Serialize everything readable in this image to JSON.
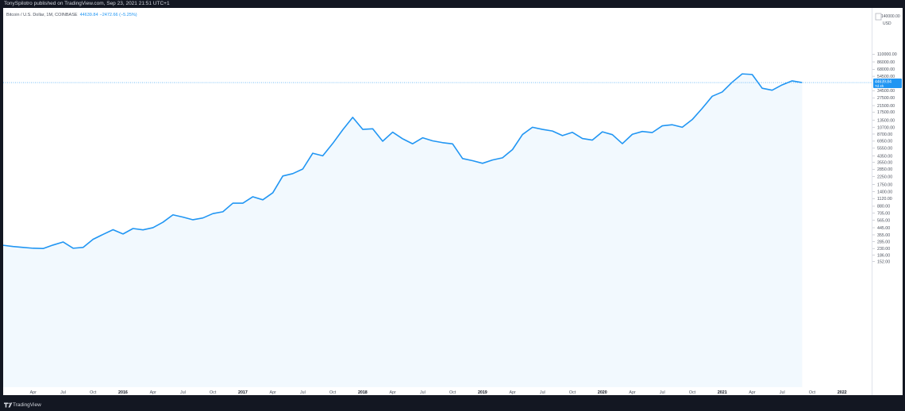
{
  "header": {
    "publisher_line": "TonySpilotro published on TradingView.com, Sep 23, 2021 21:51 UTC+1"
  },
  "legend": {
    "symbol": "Bitcoin / U.S. Dollar, 1M, COINBASE",
    "last_price": "44639.84",
    "change": "−2472.66 (−5.25%)"
  },
  "price_axis": {
    "top_label": "140000.00",
    "currency": "USD"
  },
  "price_tag": {
    "value": "44639.84",
    "countdown": "7d 4h"
  },
  "footer": {
    "brand": "TradingView",
    "brand_icon": "tradingview-logo-icon"
  },
  "colors": {
    "line": "#2196f3",
    "area_fill": "#2196f3",
    "background": "#ffffff",
    "frame": "#131722",
    "axis_text": "#4c525e"
  },
  "chart_data": {
    "type": "area",
    "title": "",
    "xlabel": "",
    "ylabel": "",
    "y_scale": "log",
    "grid": false,
    "x_ticks": [
      "Apr",
      "Jul",
      "Oct",
      "2016",
      "Apr",
      "Jul",
      "Oct",
      "2017",
      "Apr",
      "Jul",
      "Oct",
      "2018",
      "Apr",
      "Jul",
      "Oct",
      "2019",
      "Apr",
      "Jul",
      "Oct",
      "2020",
      "Apr",
      "Jul",
      "Oct",
      "2021",
      "Apr",
      "Jul",
      "Oct",
      "2022",
      "A"
    ],
    "y_ticks": [
      "110000.00",
      "86000.00",
      "68000.00",
      "54500.00",
      "34500.00",
      "27500.00",
      "21500.00",
      "17500.00",
      "13500.00",
      "10700.00",
      "8700.00",
      "6950.00",
      "5550.00",
      "4350.00",
      "3550.00",
      "2850.00",
      "2250.00",
      "1750.00",
      "1400.00",
      "1120.00",
      "880.00",
      "705.00",
      "565.00",
      "445.00",
      "355.00",
      "285.00",
      "230.00",
      "186.00",
      "152.00"
    ],
    "series": [
      {
        "x": [
          "2015-01",
          "2015-02",
          "2015-03",
          "2015-04",
          "2015-05",
          "2015-06",
          "2015-07",
          "2015-08",
          "2015-09",
          "2015-10",
          "2015-11",
          "2015-12",
          "2016-01",
          "2016-02",
          "2016-03",
          "2016-04",
          "2016-05",
          "2016-06",
          "2016-07",
          "2016-08",
          "2016-09",
          "2016-10",
          "2016-11",
          "2016-12",
          "2017-01",
          "2017-02",
          "2017-03",
          "2017-04",
          "2017-05",
          "2017-06",
          "2017-07",
          "2017-08",
          "2017-09",
          "2017-10",
          "2017-11",
          "2017-12",
          "2018-01",
          "2018-02",
          "2018-03",
          "2018-04",
          "2018-05",
          "2018-06",
          "2018-07",
          "2018-08",
          "2018-09",
          "2018-10",
          "2018-11",
          "2018-12",
          "2019-01",
          "2019-02",
          "2019-03",
          "2019-04",
          "2019-05",
          "2019-06",
          "2019-07",
          "2019-08",
          "2019-09",
          "2019-10",
          "2019-11",
          "2019-12",
          "2020-01",
          "2020-02",
          "2020-03",
          "2020-04",
          "2020-05",
          "2020-06",
          "2020-07",
          "2020-08",
          "2020-09",
          "2020-10",
          "2020-11",
          "2020-12",
          "2021-01",
          "2021-02",
          "2021-03",
          "2021-04",
          "2021-05",
          "2021-06",
          "2021-07",
          "2021-08",
          "2021-09"
        ],
        "values": [
          255,
          245,
          238,
          232,
          230,
          257,
          283,
          232,
          238,
          308,
          360,
          418,
          365,
          434,
          416,
          446,
          530,
          670,
          623,
          573,
          607,
          697,
          739,
          970,
          970,
          1190,
          1080,
          1350,
          2300,
          2480,
          2870,
          4740,
          4360,
          6460,
          9950,
          14800,
          10100,
          10300,
          6930,
          9240,
          7490,
          6390,
          7730,
          7020,
          6630,
          6370,
          4000,
          3740,
          3440,
          3820,
          4100,
          5320,
          8570,
          10800,
          10100,
          9590,
          8290,
          9200,
          7560,
          7190,
          9350,
          8550,
          6420,
          8640,
          9450,
          9140,
          11300,
          11700,
          10800,
          13800,
          19700,
          28900,
          33100,
          45200,
          58800,
          57700,
          37300,
          35000,
          41500,
          47100,
          44639
        ]
      }
    ]
  }
}
